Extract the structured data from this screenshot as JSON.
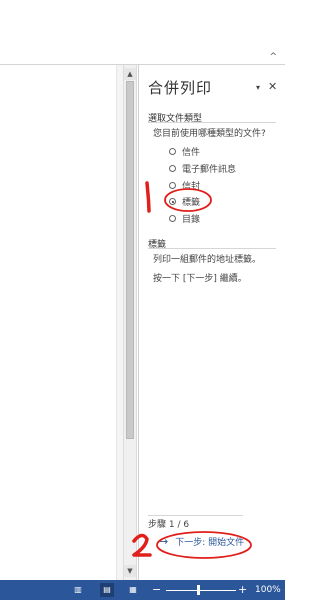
{
  "ribbon": {
    "collapse_icon": "chevron-up-icon",
    "collapse_glyph": "^"
  },
  "pane": {
    "title": "合併列印",
    "menu_glyph": "▾",
    "close_glyph": "✕",
    "section1": {
      "header": "選取文件類型",
      "question": "您目前使用哪種類型的文件?",
      "options": [
        {
          "label": "信件",
          "selected": false
        },
        {
          "label": "電子郵件訊息",
          "selected": false
        },
        {
          "label": "信封",
          "selected": false
        },
        {
          "label": "標籤",
          "selected": true
        },
        {
          "label": "目錄",
          "selected": false
        }
      ]
    },
    "section2": {
      "header": "標籤",
      "line1": "列印一組郵件的地址標籤。",
      "line2": "按一下 [下一步] 繼續。"
    },
    "step_text": "步驟 1 / 6",
    "next_link": "下一步: 開始文件"
  },
  "annotations": {
    "num1": "1",
    "num2": "2",
    "color": "#e0201b"
  },
  "statusbar": {
    "zoom_minus": "−",
    "zoom_plus": "+",
    "zoom_percent": "100%",
    "zoom_level": 100,
    "active_view": "print-layout"
  }
}
